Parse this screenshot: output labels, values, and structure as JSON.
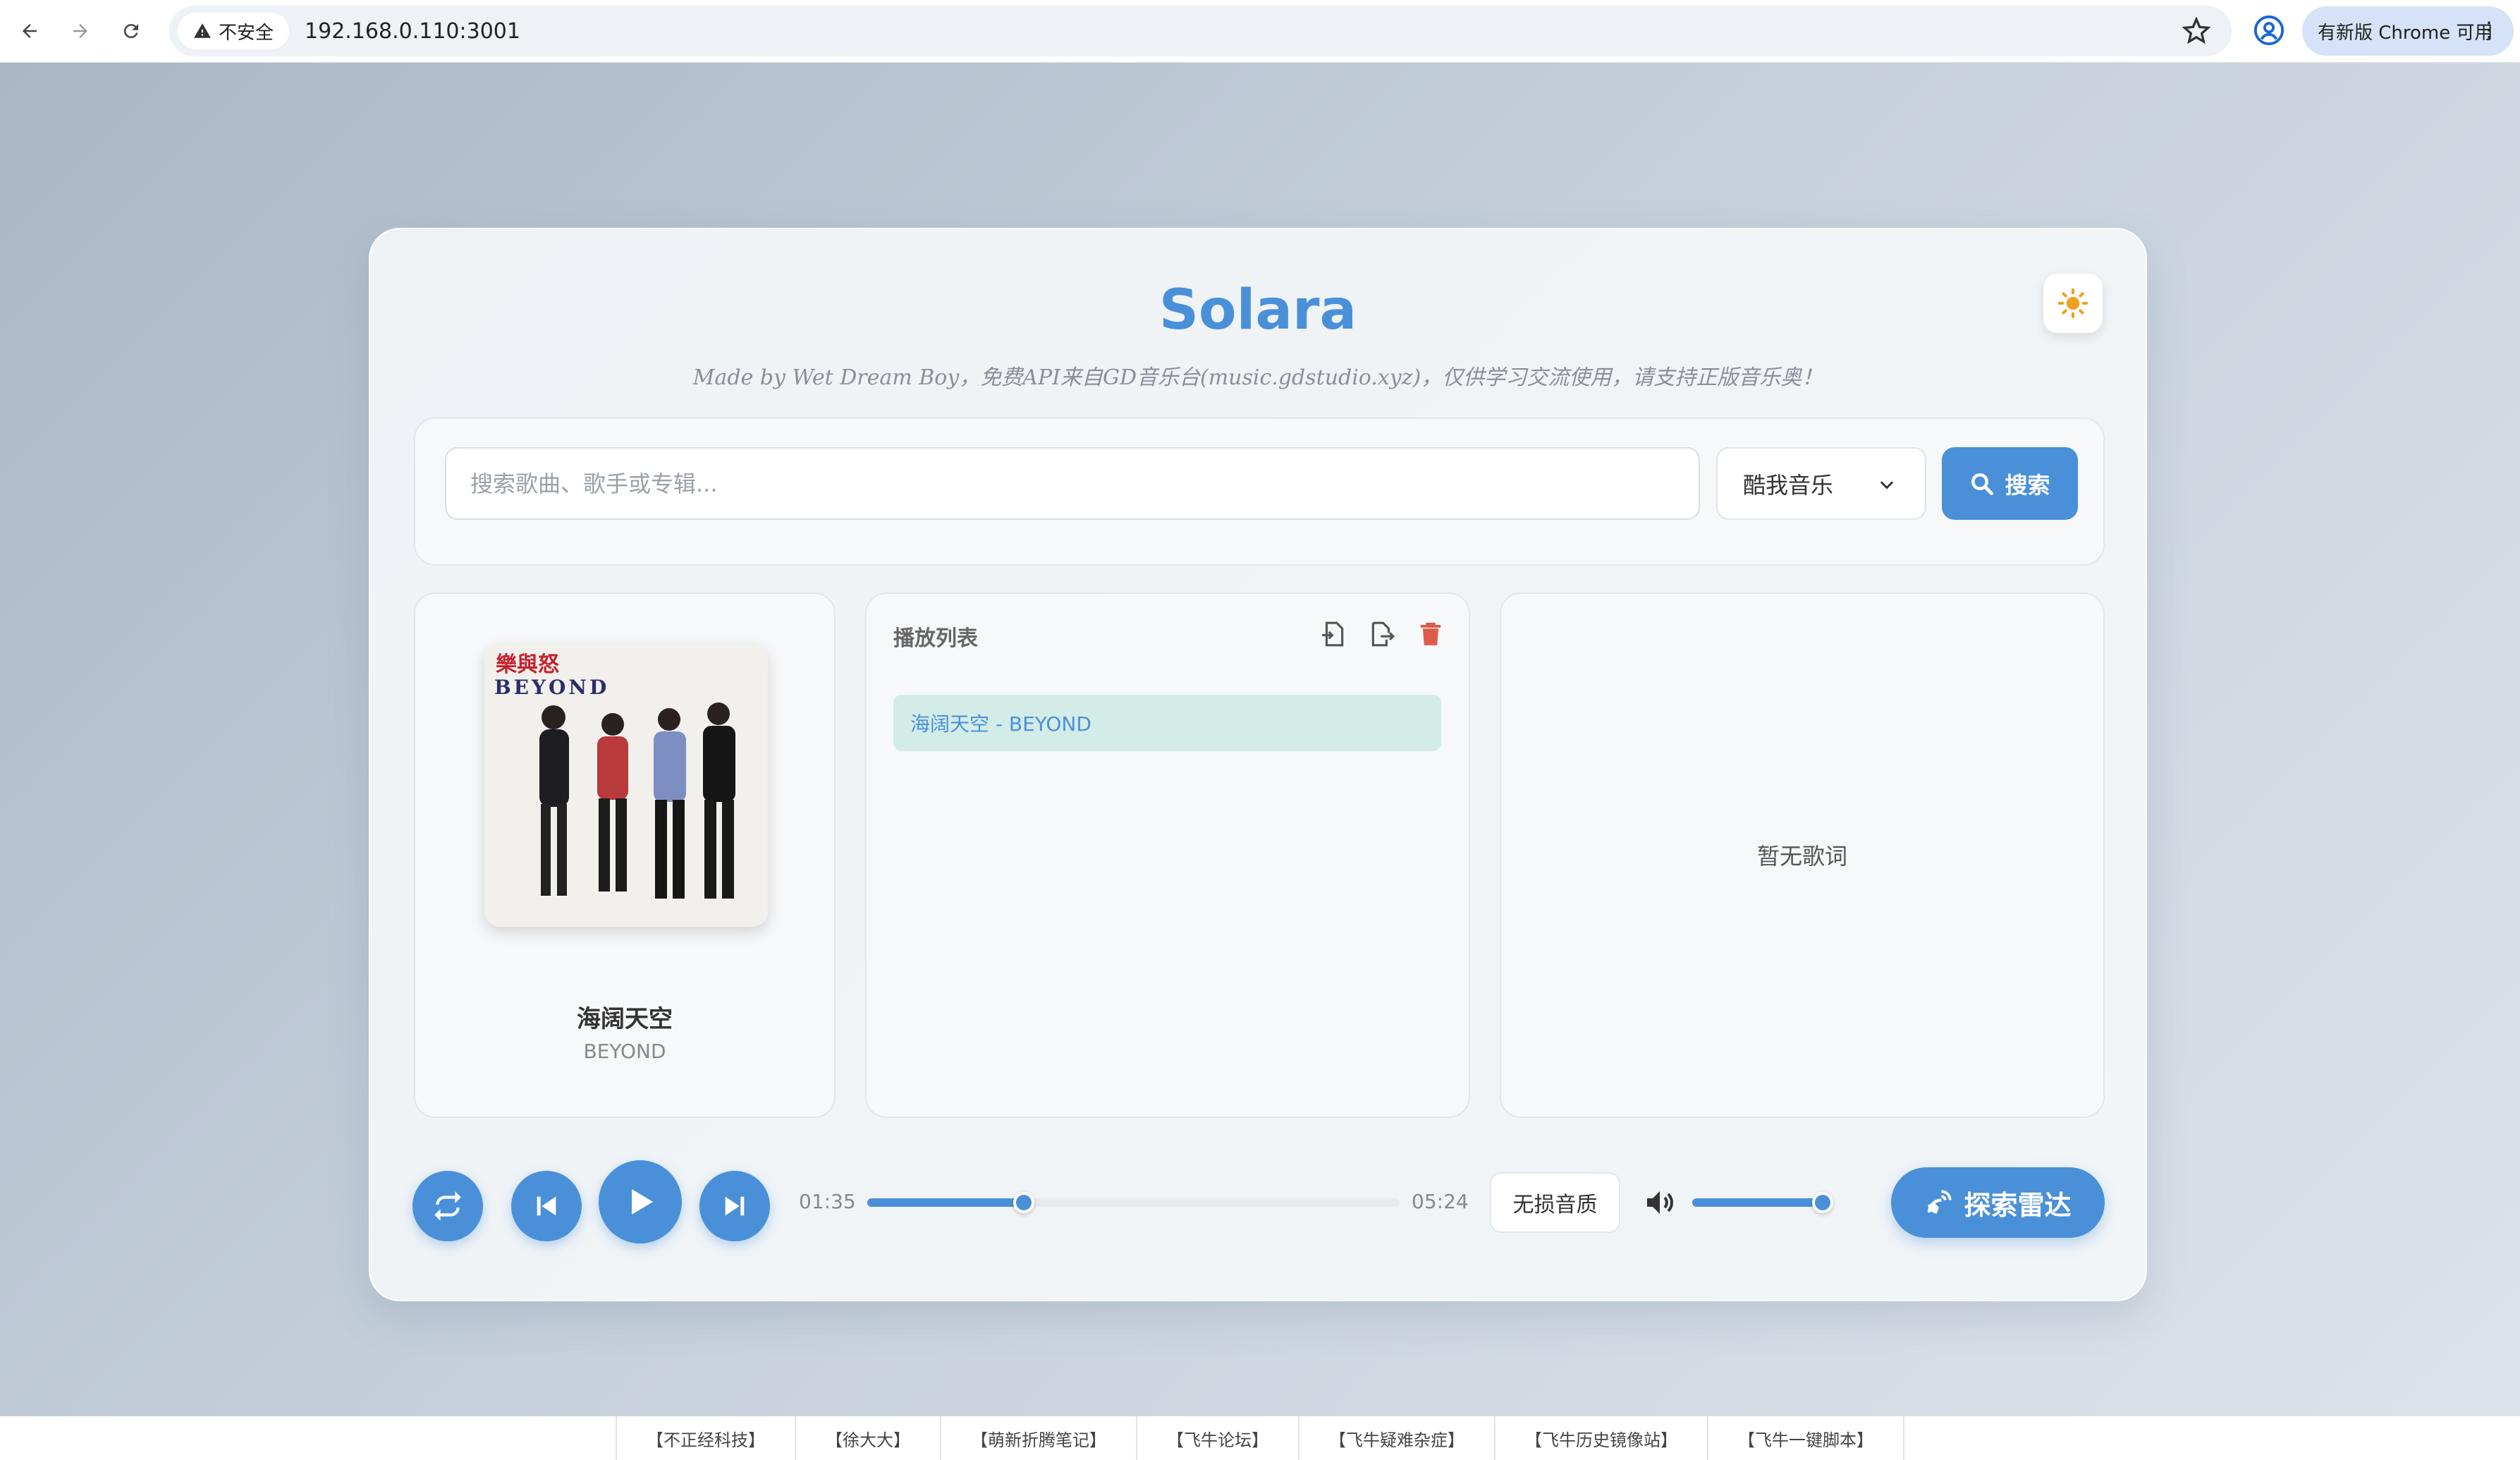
{
  "browser": {
    "security_label": "不安全",
    "url": "192.168.0.110:3001",
    "update_label": "有新版 Chrome 可用"
  },
  "app": {
    "title": "Solara",
    "subtitle": "Made by Wet Dream Boy，免费API来自GD音乐台(music.gdstudio.xyz)，仅供学习交流使用，请支持正版音乐奥！"
  },
  "search": {
    "placeholder": "搜索歌曲、歌手或专辑...",
    "source_selected": "酷我音乐",
    "button_label": "搜索"
  },
  "now_playing": {
    "title": "海阔天空",
    "artist": "BEYOND",
    "album_text_cn": "樂與怒",
    "album_text_en": "BEYOND"
  },
  "playlist": {
    "title": "播放列表",
    "items": [
      {
        "label": "海阔天空 - BEYOND",
        "active": true
      }
    ]
  },
  "lyrics": {
    "empty_text": "暂无歌词"
  },
  "player": {
    "current_time": "01:35",
    "total_time": "05:24",
    "progress": 0.294,
    "quality_label": "无损音质",
    "volume": 1.0,
    "radar_label": "探索雷达"
  },
  "colors": {
    "accent": "#4a90d9",
    "danger": "#e05a4a",
    "theme_icon": "#f0a020",
    "active_item_bg": "#d3ece7"
  },
  "footer": {
    "links": [
      "【不正经科技】",
      "【徐大大】",
      "【萌新折腾笔记】",
      "【飞牛论坛】",
      "【飞牛疑难杂症】",
      "【飞牛历史镜像站】",
      "【飞牛一键脚本】"
    ]
  }
}
